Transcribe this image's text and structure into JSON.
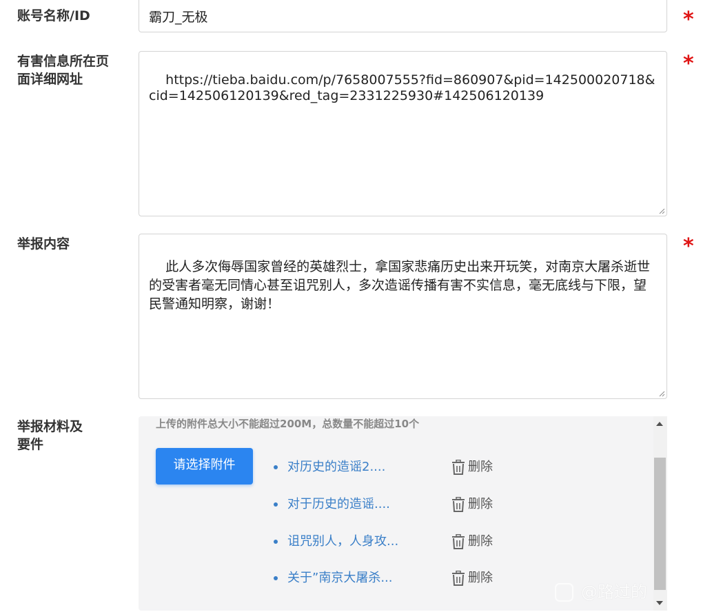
{
  "colors": {
    "required": "#e01515",
    "primary_button": "#2b85f0",
    "file_link": "#3a7fc8",
    "border": "#d4d4d4",
    "panel_bg": "#f4f4f5"
  },
  "form": {
    "account": {
      "label": "账号名称/ID",
      "value": "霸刀_无极",
      "required_mark": "*"
    },
    "url": {
      "label_line1": "有害信息所在页",
      "label_line2": "面详细网址",
      "value": "https://tieba.baidu.com/p/7658007555?fid=860907&pid=142500020718&cid=142506120139&red_tag=2331225930#142506120139",
      "required_mark": "*"
    },
    "report_content": {
      "label": "举报内容",
      "value": "此人多次侮辱国家曾经的英雄烈士，拿国家悲痛历史出来开玩笑，对南京大屠杀逝世的受害者毫无同情心甚至诅咒别人，多次造谣传播有害不实信息，毫无底线与下限，望民警通知明察，谢谢！",
      "required_mark": "*"
    },
    "attachments": {
      "label_line1": "举报材料及",
      "label_line2": "要件",
      "hint": "上传的附件总大小不能超过200M，总数量不能超过10个",
      "choose_button": "请选择附件",
      "files": [
        {
          "name": "对历史的造谣2....",
          "delete_label": "删除"
        },
        {
          "name": "对于历史的造谣....",
          "delete_label": "删除"
        },
        {
          "name": "诅咒别人，人身攻...",
          "delete_label": "删除"
        },
        {
          "name": "关于”南京大屠杀...",
          "delete_label": "删除"
        }
      ]
    }
  },
  "watermark": {
    "text": "@路过的",
    "icon": "chat-bubble-icon"
  }
}
